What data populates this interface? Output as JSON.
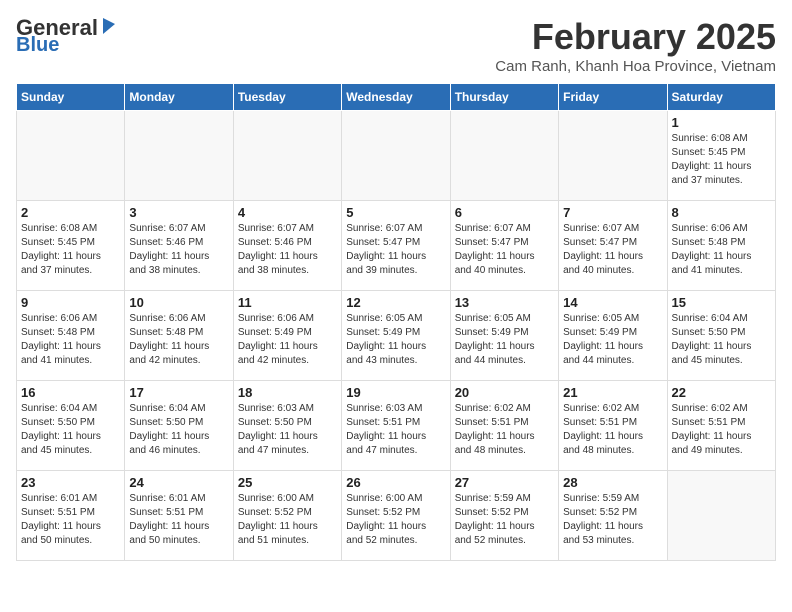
{
  "header": {
    "logo_line1": "General",
    "logo_line2": "Blue",
    "month_title": "February 2025",
    "location": "Cam Ranh, Khanh Hoa Province, Vietnam"
  },
  "days_of_week": [
    "Sunday",
    "Monday",
    "Tuesday",
    "Wednesday",
    "Thursday",
    "Friday",
    "Saturday"
  ],
  "weeks": [
    [
      {
        "day": "",
        "info": ""
      },
      {
        "day": "",
        "info": ""
      },
      {
        "day": "",
        "info": ""
      },
      {
        "day": "",
        "info": ""
      },
      {
        "day": "",
        "info": ""
      },
      {
        "day": "",
        "info": ""
      },
      {
        "day": "1",
        "info": "Sunrise: 6:08 AM\nSunset: 5:45 PM\nDaylight: 11 hours\nand 37 minutes."
      }
    ],
    [
      {
        "day": "2",
        "info": "Sunrise: 6:08 AM\nSunset: 5:45 PM\nDaylight: 11 hours\nand 37 minutes."
      },
      {
        "day": "3",
        "info": "Sunrise: 6:07 AM\nSunset: 5:46 PM\nDaylight: 11 hours\nand 38 minutes."
      },
      {
        "day": "4",
        "info": "Sunrise: 6:07 AM\nSunset: 5:46 PM\nDaylight: 11 hours\nand 38 minutes."
      },
      {
        "day": "5",
        "info": "Sunrise: 6:07 AM\nSunset: 5:47 PM\nDaylight: 11 hours\nand 39 minutes."
      },
      {
        "day": "6",
        "info": "Sunrise: 6:07 AM\nSunset: 5:47 PM\nDaylight: 11 hours\nand 40 minutes."
      },
      {
        "day": "7",
        "info": "Sunrise: 6:07 AM\nSunset: 5:47 PM\nDaylight: 11 hours\nand 40 minutes."
      },
      {
        "day": "8",
        "info": "Sunrise: 6:06 AM\nSunset: 5:48 PM\nDaylight: 11 hours\nand 41 minutes."
      }
    ],
    [
      {
        "day": "9",
        "info": "Sunrise: 6:06 AM\nSunset: 5:48 PM\nDaylight: 11 hours\nand 41 minutes."
      },
      {
        "day": "10",
        "info": "Sunrise: 6:06 AM\nSunset: 5:48 PM\nDaylight: 11 hours\nand 42 minutes."
      },
      {
        "day": "11",
        "info": "Sunrise: 6:06 AM\nSunset: 5:49 PM\nDaylight: 11 hours\nand 42 minutes."
      },
      {
        "day": "12",
        "info": "Sunrise: 6:05 AM\nSunset: 5:49 PM\nDaylight: 11 hours\nand 43 minutes."
      },
      {
        "day": "13",
        "info": "Sunrise: 6:05 AM\nSunset: 5:49 PM\nDaylight: 11 hours\nand 44 minutes."
      },
      {
        "day": "14",
        "info": "Sunrise: 6:05 AM\nSunset: 5:49 PM\nDaylight: 11 hours\nand 44 minutes."
      },
      {
        "day": "15",
        "info": "Sunrise: 6:04 AM\nSunset: 5:50 PM\nDaylight: 11 hours\nand 45 minutes."
      }
    ],
    [
      {
        "day": "16",
        "info": "Sunrise: 6:04 AM\nSunset: 5:50 PM\nDaylight: 11 hours\nand 45 minutes."
      },
      {
        "day": "17",
        "info": "Sunrise: 6:04 AM\nSunset: 5:50 PM\nDaylight: 11 hours\nand 46 minutes."
      },
      {
        "day": "18",
        "info": "Sunrise: 6:03 AM\nSunset: 5:50 PM\nDaylight: 11 hours\nand 47 minutes."
      },
      {
        "day": "19",
        "info": "Sunrise: 6:03 AM\nSunset: 5:51 PM\nDaylight: 11 hours\nand 47 minutes."
      },
      {
        "day": "20",
        "info": "Sunrise: 6:02 AM\nSunset: 5:51 PM\nDaylight: 11 hours\nand 48 minutes."
      },
      {
        "day": "21",
        "info": "Sunrise: 6:02 AM\nSunset: 5:51 PM\nDaylight: 11 hours\nand 48 minutes."
      },
      {
        "day": "22",
        "info": "Sunrise: 6:02 AM\nSunset: 5:51 PM\nDaylight: 11 hours\nand 49 minutes."
      }
    ],
    [
      {
        "day": "23",
        "info": "Sunrise: 6:01 AM\nSunset: 5:51 PM\nDaylight: 11 hours\nand 50 minutes."
      },
      {
        "day": "24",
        "info": "Sunrise: 6:01 AM\nSunset: 5:51 PM\nDaylight: 11 hours\nand 50 minutes."
      },
      {
        "day": "25",
        "info": "Sunrise: 6:00 AM\nSunset: 5:52 PM\nDaylight: 11 hours\nand 51 minutes."
      },
      {
        "day": "26",
        "info": "Sunrise: 6:00 AM\nSunset: 5:52 PM\nDaylight: 11 hours\nand 52 minutes."
      },
      {
        "day": "27",
        "info": "Sunrise: 5:59 AM\nSunset: 5:52 PM\nDaylight: 11 hours\nand 52 minutes."
      },
      {
        "day": "28",
        "info": "Sunrise: 5:59 AM\nSunset: 5:52 PM\nDaylight: 11 hours\nand 53 minutes."
      },
      {
        "day": "",
        "info": ""
      }
    ]
  ]
}
